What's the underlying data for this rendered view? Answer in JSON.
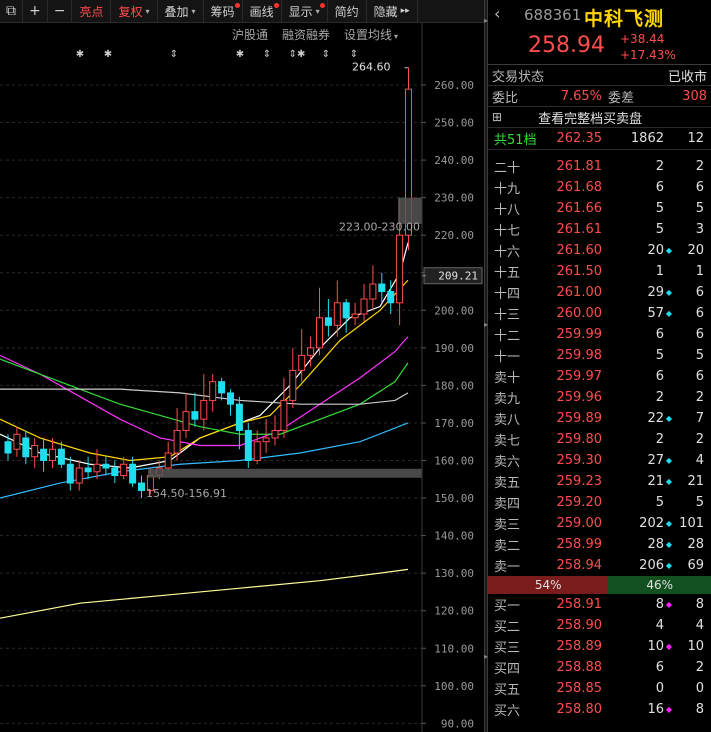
{
  "toolbar": {
    "items": [
      {
        "label": "⧉",
        "active": false
      },
      {
        "label": "+",
        "active": false
      },
      {
        "label": "−",
        "active": false
      },
      {
        "label": "亮点",
        "active": true
      },
      {
        "label": "复权",
        "active": true,
        "caret": true
      },
      {
        "label": "叠加",
        "caret": true
      },
      {
        "label": "筹码",
        "dot": true
      },
      {
        "label": "画线",
        "dot": true
      },
      {
        "label": "显示",
        "caret": true,
        "dot": true
      },
      {
        "label": "简约"
      },
      {
        "label": "隐藏",
        "suffix": "▸▸"
      }
    ]
  },
  "indicator_bar": {
    "items": [
      "沪股通",
      "融资融券",
      "设置均线"
    ]
  },
  "price_axis": {
    "ticks": [
      "260.00",
      "250.00",
      "240.00",
      "230.00",
      "220.00",
      "210.00",
      "200.00",
      "190.00",
      "180.00",
      "170.00",
      "160.00",
      "150.00",
      "140.00",
      "130.00",
      "120.00",
      "110.00",
      "100.00",
      "90.00"
    ],
    "current_label": "209.21"
  },
  "annotations": {
    "high": "264.60",
    "zone_top": "223.00-230.00",
    "zone_bottom": "154.50-156.91"
  },
  "markers": [
    "✱",
    "✱",
    "⇕",
    "✱",
    "⇕",
    "⇕✱",
    "⇕",
    "⇕"
  ],
  "stock": {
    "code": "688361",
    "name": "中科飞测",
    "price": "258.94",
    "change": "+38.44",
    "change_pct": "+17.43%",
    "back_icon": "‹"
  },
  "status": {
    "label": "交易状态",
    "value": "已收市"
  },
  "ratio_row": {
    "wb_label": "委比",
    "wb_value": "7.65%",
    "wc_label": "委差",
    "wc_value": "308"
  },
  "full_book": {
    "label": "查看完整档买卖盘",
    "icon": "⊞"
  },
  "total_row": {
    "label": "共51档",
    "price": "262.35",
    "qty": "1862",
    "count": "12"
  },
  "asks": [
    {
      "level": "二十",
      "price": "261.81",
      "qty": "2",
      "mark": "",
      "count": "2"
    },
    {
      "level": "十九",
      "price": "261.68",
      "qty": "6",
      "mark": "",
      "count": "6"
    },
    {
      "level": "十八",
      "price": "261.66",
      "qty": "5",
      "mark": "",
      "count": "5"
    },
    {
      "level": "十七",
      "price": "261.61",
      "qty": "5",
      "mark": "",
      "count": "3"
    },
    {
      "level": "十六",
      "price": "261.60",
      "qty": "20",
      "mark": "◆",
      "count": "20"
    },
    {
      "level": "十五",
      "price": "261.50",
      "qty": "1",
      "mark": "",
      "count": "1"
    },
    {
      "level": "十四",
      "price": "261.00",
      "qty": "29",
      "mark": "◆",
      "count": "6"
    },
    {
      "level": "十三",
      "price": "260.00",
      "qty": "57",
      "mark": "◆",
      "count": "6"
    },
    {
      "level": "十二",
      "price": "259.99",
      "qty": "6",
      "mark": "",
      "count": "6"
    },
    {
      "level": "十一",
      "price": "259.98",
      "qty": "5",
      "mark": "",
      "count": "5"
    },
    {
      "level": "卖十",
      "price": "259.97",
      "qty": "6",
      "mark": "",
      "count": "6"
    },
    {
      "level": "卖九",
      "price": "259.96",
      "qty": "2",
      "mark": "",
      "count": "2"
    },
    {
      "level": "卖八",
      "price": "259.89",
      "qty": "22",
      "mark": "◆",
      "count": "7"
    },
    {
      "level": "卖七",
      "price": "259.80",
      "qty": "2",
      "mark": "",
      "count": "2"
    },
    {
      "level": "卖六",
      "price": "259.30",
      "qty": "27",
      "mark": "◆",
      "count": "4"
    },
    {
      "level": "卖五",
      "price": "259.23",
      "qty": "21",
      "mark": "◆",
      "count": "21"
    },
    {
      "level": "卖四",
      "price": "259.20",
      "qty": "5",
      "mark": "",
      "count": "5"
    },
    {
      "level": "卖三",
      "price": "259.00",
      "qty": "202",
      "mark": "◆",
      "count": "101"
    },
    {
      "level": "卖二",
      "price": "258.99",
      "qty": "28",
      "mark": "◆",
      "count": "28"
    },
    {
      "level": "卖一",
      "price": "258.94",
      "qty": "206",
      "mark": "◆",
      "count": "69"
    }
  ],
  "split": {
    "sell_pct": "54%",
    "buy_pct": "46%",
    "sell_fraction": 0.54
  },
  "bids": [
    {
      "level": "买一",
      "price": "258.91",
      "qty": "8",
      "mark": "◆",
      "count": "8"
    },
    {
      "level": "买二",
      "price": "258.90",
      "qty": "4",
      "mark": "",
      "count": "4"
    },
    {
      "level": "买三",
      "price": "258.89",
      "qty": "10",
      "mark": "◆",
      "count": "10"
    },
    {
      "level": "买四",
      "price": "258.88",
      "qty": "6",
      "mark": "",
      "count": "2"
    },
    {
      "level": "买五",
      "price": "258.85",
      "qty": "0",
      "mark": "",
      "count": "0"
    },
    {
      "level": "买六",
      "price": "258.80",
      "qty": "16",
      "mark": "◆",
      "count": "8"
    }
  ],
  "colors": {
    "up": "#ff4d4d",
    "down": "#22ddee",
    "accent": "#ffd600",
    "ma5": "#ffffff",
    "ma10": "#ffd600",
    "ma20": "#ff33ff",
    "ma30": "#33dd33",
    "ma60": "#33bbff",
    "ma120": "#cccccc",
    "ma250": "#ffff99"
  }
}
